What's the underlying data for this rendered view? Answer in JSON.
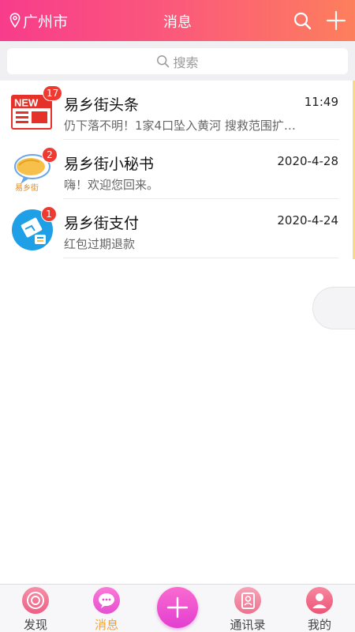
{
  "header": {
    "location": "广州市",
    "title": "消息"
  },
  "search": {
    "placeholder": "搜索"
  },
  "messages": [
    {
      "title": "易乡街头条",
      "time": "11:49",
      "preview": "仍下落不明！1家4口坠入黄河 搜救范围扩…",
      "badge": "17",
      "icon": "news-icon",
      "avatar_text": "NEW"
    },
    {
      "title": "易乡街小秘书",
      "time": "2020-4-28",
      "preview": "嗨！欢迎您回来。",
      "badge": "2",
      "icon": "assistant-chat-icon",
      "avatar_text": "易乡街"
    },
    {
      "title": "易乡街支付",
      "time": "2020-4-24",
      "preview": "红包过期退款",
      "badge": "1",
      "icon": "payment-icon"
    }
  ],
  "tabbar": {
    "items": [
      {
        "label": "发现",
        "icon": "discover-icon",
        "active": false
      },
      {
        "label": "消息",
        "icon": "message-icon",
        "active": true
      },
      {
        "label": "通讯录",
        "icon": "contacts-icon",
        "active": false
      },
      {
        "label": "我的",
        "icon": "profile-icon",
        "active": false
      }
    ],
    "center_icon": "plus-icon"
  },
  "colors": {
    "header_gradient_start": "#f83c8c",
    "header_gradient_end": "#fd7f5c",
    "badge": "#ee3a30",
    "active_tab": "#f1a436",
    "center_button": "#e84ad2"
  }
}
